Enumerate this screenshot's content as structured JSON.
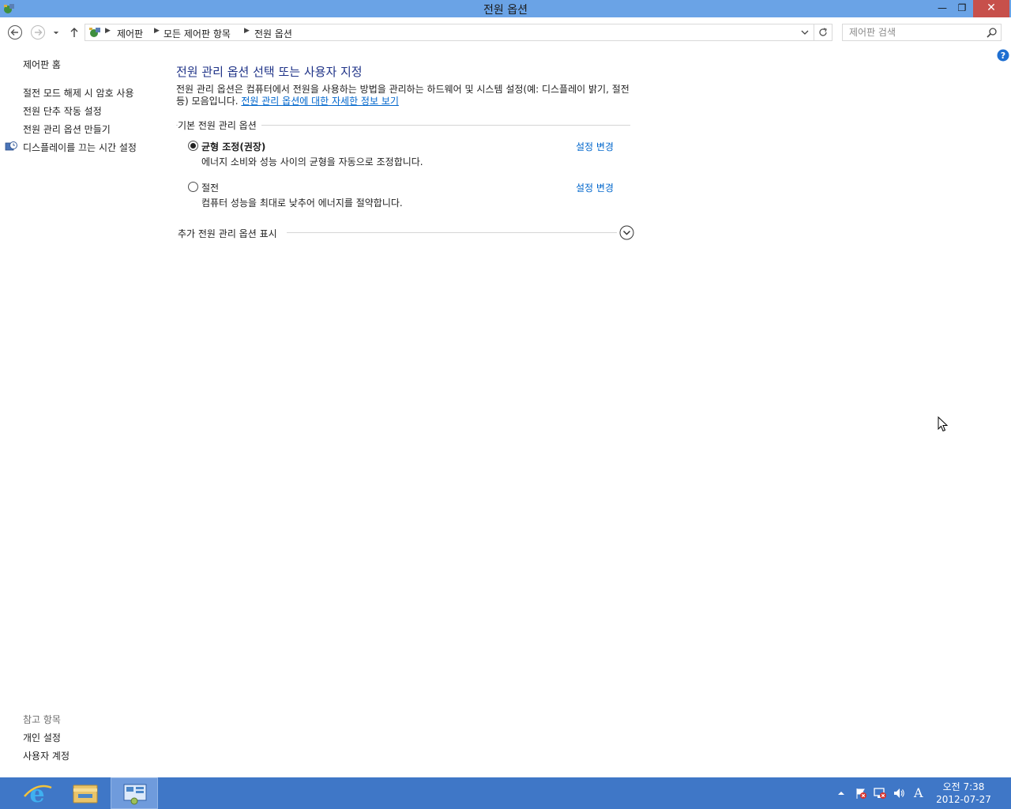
{
  "window": {
    "title": "전원 옵션",
    "controls": {
      "minimize": "—",
      "maximize": "❐",
      "close": "✕"
    }
  },
  "address_bar": {
    "breadcrumbs": [
      "제어판",
      "모든 제어판 항목",
      "전원 옵션"
    ]
  },
  "search": {
    "placeholder": "제어판 검색",
    "value": ""
  },
  "left_pane": {
    "home": "제어판 홈",
    "links": [
      "절전 모드 해제 시 암호 사용",
      "전원 단추 작동 설정",
      "전원 관리 옵션 만들기",
      "디스플레이를 끄는 시간 설정"
    ],
    "see_also": {
      "title": "참고 항목",
      "links": [
        "개인 설정",
        "사용자 계정"
      ]
    }
  },
  "main": {
    "heading": "전원 관리 옵션 선택 또는 사용자 지정",
    "description": "전원 관리 옵션은 컴퓨터에서 전원을 사용하는 방법을 관리하는 하드웨어 및 시스템 설정(예: 디스플레이 밝기, 절전 등) 모음입니다. ",
    "info_link": "전원 관리 옵션에 대한 자세한 정보 보기",
    "group_title": "기본 전원 관리 옵션",
    "plans": [
      {
        "name": "균형 조정(권장)",
        "description": "에너지 소비와 성능 사이의 균형을 자동으로 조정합니다.",
        "change": "설정 변경",
        "selected": true
      },
      {
        "name": "절전",
        "description": "컴퓨터 성능을 최대로 낮추어 에너지를 절약합니다.",
        "change": "설정 변경",
        "selected": false
      }
    ],
    "more_plans": "추가 전원 관리 옵션 표시"
  },
  "taskbar": {
    "ime": "A",
    "clock": {
      "time": "오전 7:38",
      "date": "2012-07-27"
    }
  },
  "colors": {
    "titlebar": "#6aa3e6",
    "close_button": "#c7504b",
    "heading": "#1e3287",
    "link": "#0066cc",
    "taskbar": "#3f77c7"
  }
}
